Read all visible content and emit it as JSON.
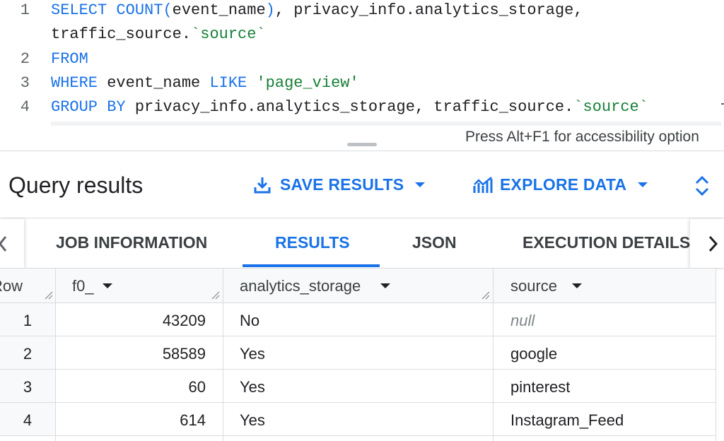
{
  "editor": {
    "line_numbers": [
      "1",
      "2",
      "3",
      "4"
    ],
    "line1a": {
      "kw1": "SELECT",
      "kw2": "COUNT",
      "p1": "(",
      "arg": "event_name",
      "p2": ")",
      "rest": ", privacy_info.analytics_storage,"
    },
    "line1b": {
      "pre": "traffic_source.",
      "str": "`source`"
    },
    "line2": {
      "kw": "FROM"
    },
    "line3": {
      "kw1": "WHERE",
      "mid": " event_name ",
      "kw2": "LIKE",
      "sp": " ",
      "str": "'page_view'"
    },
    "line4": {
      "kw": "GROUP BY",
      "mid": " privacy_info.analytics_storage, traffic_source.",
      "str": "`source`"
    },
    "accessibility_hint": "Press Alt+F1 for accessibility option"
  },
  "results": {
    "title": "Query results",
    "save_label": "SAVE RESULTS",
    "explore_label": "EXPLORE DATA"
  },
  "tabs": [
    {
      "label": "JOB INFORMATION"
    },
    {
      "label": "RESULTS"
    },
    {
      "label": "JSON"
    },
    {
      "label": "EXECUTION DETAILS"
    }
  ],
  "table": {
    "headers": {
      "row": "Row",
      "f0": "f0_",
      "analytics": "analytics_storage",
      "source": "source"
    },
    "rows": [
      {
        "row": "1",
        "f0": "43209",
        "analytics": "No",
        "source": "null"
      },
      {
        "row": "2",
        "f0": "58589",
        "analytics": "Yes",
        "source": "google"
      },
      {
        "row": "3",
        "f0": "60",
        "analytics": "Yes",
        "source": "pinterest"
      },
      {
        "row": "4",
        "f0": "614",
        "analytics": "Yes",
        "source": "Instagram_Feed"
      }
    ]
  },
  "colors": {
    "accent": "#1a73e8",
    "string": "#188038"
  }
}
